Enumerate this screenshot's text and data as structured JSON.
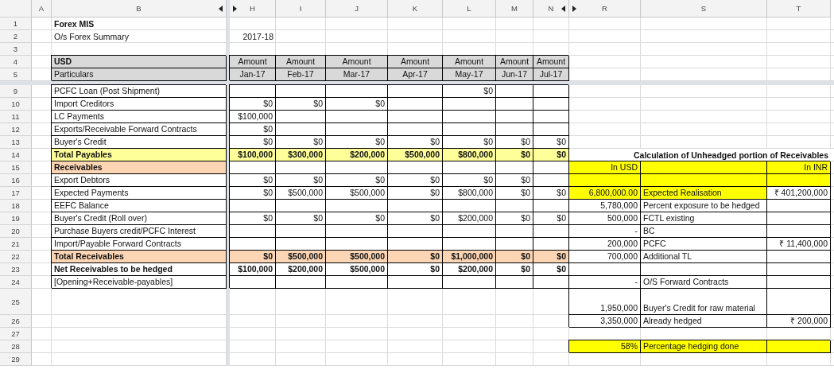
{
  "columns": [
    {
      "label": "A",
      "hidden_before": false,
      "hidden_after": false
    },
    {
      "label": "B",
      "hidden_before": false,
      "hidden_after": true
    },
    {
      "label": "H",
      "hidden_before": true,
      "hidden_after": false
    },
    {
      "label": "I",
      "hidden_before": false,
      "hidden_after": false
    },
    {
      "label": "J",
      "hidden_before": false,
      "hidden_after": false
    },
    {
      "label": "K",
      "hidden_before": false,
      "hidden_after": false
    },
    {
      "label": "L",
      "hidden_before": false,
      "hidden_after": false
    },
    {
      "label": "M",
      "hidden_before": false,
      "hidden_after": false
    },
    {
      "label": "N",
      "hidden_before": false,
      "hidden_after": true
    },
    {
      "label": "R",
      "hidden_before": true,
      "hidden_after": false
    },
    {
      "label": "S",
      "hidden_before": false,
      "hidden_after": false
    },
    {
      "label": "T",
      "hidden_before": false,
      "hidden_after": false
    }
  ],
  "rows": [
    {
      "num": "1",
      "kind": "title",
      "cells": [
        null,
        "Forex MIS",
        null,
        null,
        null,
        null,
        null,
        null,
        null
      ],
      "calc": {
        "kind": "none",
        "cells": [
          null,
          null,
          null
        ]
      }
    },
    {
      "num": "2",
      "kind": "plain",
      "cells": [
        null,
        "O/s Forex Summary",
        "2017-18",
        null,
        null,
        null,
        null,
        null,
        null
      ],
      "calc": {
        "kind": "none",
        "cells": [
          null,
          null,
          null
        ]
      }
    },
    {
      "num": "3",
      "kind": "plain",
      "cells": [
        null,
        null,
        null,
        null,
        null,
        null,
        null,
        null,
        null
      ],
      "calc": {
        "kind": "none",
        "cells": [
          null,
          null,
          null
        ]
      }
    },
    {
      "num": "4",
      "kind": "head_top",
      "cells": [
        null,
        "USD",
        "Amount",
        "Amount",
        "Amount",
        "Amount",
        "Amount",
        "Amount",
        "Amount"
      ],
      "calc": {
        "kind": "none",
        "cells": [
          null,
          null,
          null
        ]
      }
    },
    {
      "num": "5",
      "kind": "head",
      "frozen_below": true,
      "cells": [
        null,
        "Particulars",
        "Jan-17",
        "Feb-17",
        "Mar-17",
        "Apr-17",
        "May-17",
        "Jun-17",
        "Jul-17"
      ],
      "calc": {
        "kind": "none",
        "cells": [
          null,
          null,
          null
        ]
      }
    },
    {
      "num": "9",
      "kind": "item",
      "cells": [
        null,
        "PCFC Loan (Post Shipment)",
        null,
        null,
        null,
        null,
        "$0",
        null,
        null
      ],
      "calc": {
        "kind": "none",
        "cells": [
          null,
          null,
          null
        ]
      }
    },
    {
      "num": "10",
      "kind": "item",
      "cells": [
        null,
        "Import Creditors",
        "$0",
        "$0",
        "$0",
        null,
        null,
        null,
        null
      ],
      "calc": {
        "kind": "none",
        "cells": [
          null,
          null,
          null
        ]
      }
    },
    {
      "num": "11",
      "kind": "item",
      "cells": [
        null,
        "LC Payments",
        "$100,000",
        null,
        null,
        null,
        null,
        null,
        null
      ],
      "calc": {
        "kind": "none",
        "cells": [
          null,
          null,
          null
        ]
      }
    },
    {
      "num": "12",
      "kind": "item",
      "cells": [
        null,
        "Exports/Receivable Forward Contracts",
        "$0",
        null,
        null,
        null,
        null,
        null,
        null
      ],
      "calc": {
        "kind": "none",
        "cells": [
          null,
          null,
          null
        ]
      }
    },
    {
      "num": "13",
      "kind": "item",
      "cells": [
        null,
        "Buyer's Credit",
        "$0",
        "$0",
        "$0",
        "$0",
        "$0",
        "$0",
        "$0"
      ],
      "calc": {
        "kind": "none",
        "cells": [
          null,
          null,
          null
        ]
      }
    },
    {
      "num": "14",
      "kind": "total_payables",
      "cells": [
        null,
        "Total Payables",
        "$100,000",
        "$300,000",
        "$200,000",
        "$500,000",
        "$800,000",
        "$0",
        "$0"
      ],
      "calc": {
        "kind": "caption",
        "cells": [
          "Calculation of Unheadged portion of Receivables",
          null,
          null
        ]
      }
    },
    {
      "num": "15",
      "kind": "section",
      "cells": [
        null,
        "Receivables",
        null,
        null,
        null,
        null,
        null,
        null,
        null
      ],
      "calc": {
        "kind": "yellow_head",
        "cells": [
          "In USD",
          null,
          "In INR"
        ]
      }
    },
    {
      "num": "16",
      "kind": "item",
      "cells": [
        null,
        "Export Debtors",
        "$0",
        "$0",
        "$0",
        "$0",
        "$0",
        "$0",
        null
      ],
      "calc": {
        "kind": "yellow_head",
        "cells": [
          null,
          null,
          null
        ]
      }
    },
    {
      "num": "17",
      "kind": "item",
      "cells": [
        null,
        "Expected Payments",
        "$0",
        "$500,000",
        "$500,000",
        "$0",
        "$800,000",
        "$0",
        "$0"
      ],
      "calc": {
        "kind": "yellow_item",
        "cells": [
          "6,800,000.00",
          "Expected Realisation",
          "₹ 401,200,000"
        ]
      }
    },
    {
      "num": "18",
      "kind": "item",
      "cells": [
        null,
        "EEFC Balance",
        null,
        null,
        null,
        null,
        null,
        null,
        null
      ],
      "calc": {
        "kind": "box",
        "cells": [
          "5,780,000",
          "Percent exposure to be hedged",
          null
        ]
      }
    },
    {
      "num": "19",
      "kind": "item",
      "cells": [
        null,
        "Buyer's Credit (Roll over)",
        "$0",
        "$0",
        "$0",
        "$0",
        "$200,000",
        "$0",
        "$0"
      ],
      "calc": {
        "kind": "box",
        "cells": [
          "500,000",
          "FCTL existing",
          null
        ]
      }
    },
    {
      "num": "20",
      "kind": "item",
      "cells": [
        null,
        "Purchase Buyers credit/PCFC Interest",
        null,
        null,
        null,
        null,
        null,
        null,
        null
      ],
      "calc": {
        "kind": "box",
        "cells": [
          "-",
          "BC",
          null
        ]
      }
    },
    {
      "num": "21",
      "kind": "item",
      "cells": [
        null,
        "Import/Payable Forward Contracts",
        null,
        null,
        null,
        null,
        null,
        null,
        null
      ],
      "calc": {
        "kind": "box",
        "cells": [
          "200,000",
          "PCFC",
          "₹ 11,400,000"
        ]
      }
    },
    {
      "num": "22",
      "kind": "total_receivables",
      "cells": [
        null,
        "Total Receivables",
        "$0",
        "$500,000",
        "$500,000",
        "$0",
        "$1,000,000",
        "$0",
        "$0"
      ],
      "calc": {
        "kind": "box",
        "cells": [
          "700,000",
          "Additional TL",
          null
        ]
      }
    },
    {
      "num": "23",
      "kind": "net",
      "cells": [
        null,
        "Net Receivables to be hedged",
        "$100,000",
        "$200,000",
        "$500,000",
        "$0",
        "$200,000",
        "$0",
        "$0"
      ],
      "calc": {
        "kind": "box",
        "cells": [
          null,
          null,
          null
        ]
      }
    },
    {
      "num": "24",
      "kind": "item",
      "cells": [
        null,
        "[Opening+Receivable-payables]",
        null,
        null,
        null,
        null,
        null,
        null,
        null
      ],
      "calc": {
        "kind": "box",
        "cells": [
          "-",
          "O/S Forward Contracts",
          null
        ]
      }
    },
    {
      "num": "25",
      "kind": "plain",
      "tall": true,
      "cells": [
        null,
        null,
        null,
        null,
        null,
        null,
        null,
        null,
        null
      ],
      "calc": {
        "kind": "box",
        "cells": [
          "1,950,000",
          "Buyer's Credit for raw material",
          null
        ]
      }
    },
    {
      "num": "26",
      "kind": "plain",
      "cells": [
        null,
        null,
        null,
        null,
        null,
        null,
        null,
        null,
        null
      ],
      "calc": {
        "kind": "box",
        "cells": [
          "3,350,000",
          "Already hedged",
          "₹ 200,000"
        ]
      }
    },
    {
      "num": "27",
      "kind": "plain",
      "cells": [
        null,
        null,
        null,
        null,
        null,
        null,
        null,
        null,
        null
      ],
      "calc": {
        "kind": "none",
        "cells": [
          null,
          null,
          null
        ]
      }
    },
    {
      "num": "28",
      "kind": "plain",
      "cells": [
        null,
        null,
        null,
        null,
        null,
        null,
        null,
        null,
        null
      ],
      "calc": {
        "kind": "yellow_total",
        "cells": [
          "58%",
          "Percentage hedging done",
          null
        ]
      }
    },
    {
      "num": "29",
      "kind": "plain",
      "cells": [
        null,
        null,
        null,
        null,
        null,
        null,
        null,
        null,
        null
      ],
      "calc": {
        "kind": "none",
        "cells": [
          null,
          null,
          null
        ]
      }
    }
  ]
}
